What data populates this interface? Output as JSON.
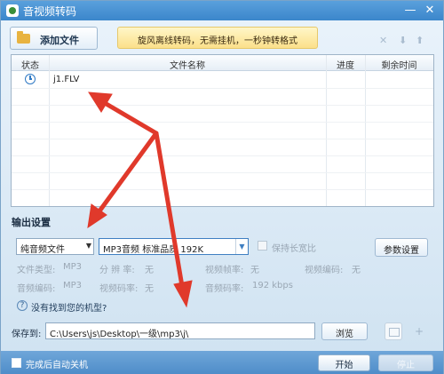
{
  "window": {
    "title": "音视频转码",
    "minimize_glyph": "—",
    "close_glyph": "✕"
  },
  "toolbar": {
    "add_file_label": "添加文件",
    "ad_text": "旋风离线转码，无需挂机，一秒钟转格式",
    "icons": [
      "delete-x-icon",
      "move-down-icon",
      "move-up-icon"
    ],
    "delete_glyph": "✕",
    "down_glyph": "⬇",
    "up_glyph": "⬆"
  },
  "file_table": {
    "columns": [
      "状态",
      "文件名称",
      "进度",
      "剩余时间"
    ],
    "rows": [
      {
        "status_icon": "clock-icon",
        "name": "j1.FLV",
        "progress": "",
        "remaining": ""
      }
    ]
  },
  "output": {
    "section_title": "输出设置",
    "file_type": "纯音频文件",
    "quality": "MP3音频 标准品质 192K",
    "keep_ratio_label": "保持长宽比",
    "param_button": "参数设置",
    "params": [
      {
        "label": "文件类型:",
        "value": "MP3"
      },
      {
        "label": "分 辨 率:",
        "value": "无"
      },
      {
        "label": "视频帧率:",
        "value": "无"
      },
      {
        "label": "视频编码:",
        "value": "无"
      },
      {
        "label": "音频编码:",
        "value": "MP3"
      },
      {
        "label": "视频码率:",
        "value": "无"
      },
      {
        "label": "音频码率:",
        "value": "192 kbps"
      }
    ],
    "help_link": "没有找到您的机型?"
  },
  "save": {
    "label": "保存到:",
    "path": "C:\\Users\\js\\Desktop\\一级\\mp3\\j\\",
    "browse_label": "浏览",
    "plus_glyph": "+"
  },
  "footer": {
    "shutdown_label": "完成后自动关机",
    "start_label": "开始",
    "stop_label": "停止"
  },
  "colors": {
    "title_bar": "#3b86cb",
    "arrow": "#e0392b",
    "ad_bg": "#fbe08a"
  }
}
